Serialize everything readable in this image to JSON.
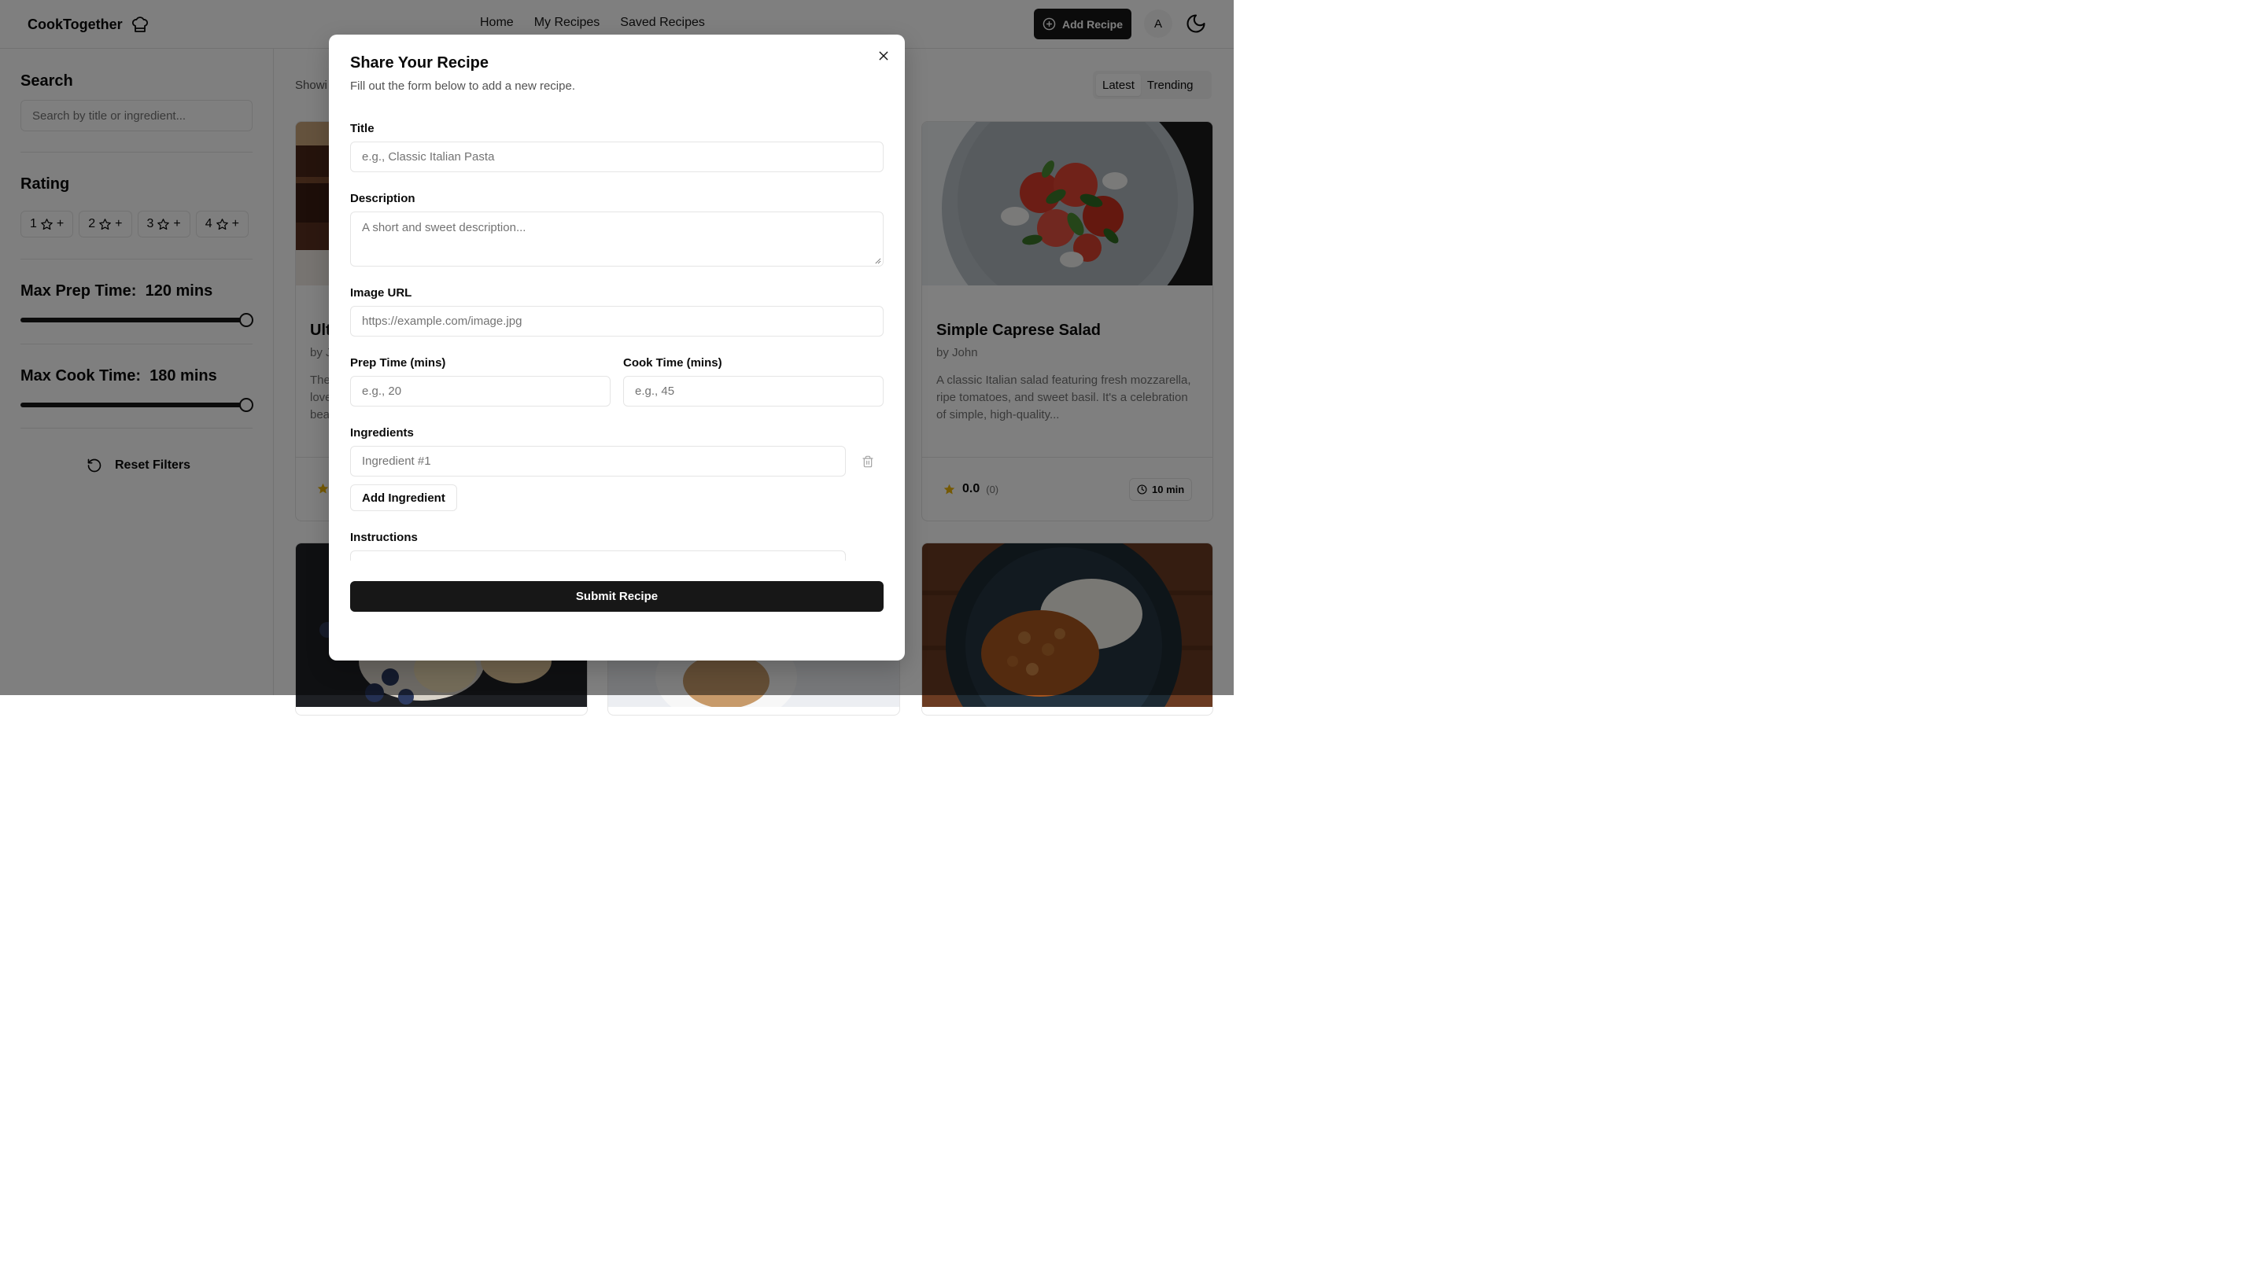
{
  "header": {
    "brand": "CookTogether",
    "nav": [
      "Home",
      "My Recipes",
      "Saved Recipes"
    ],
    "add_recipe": "Add Recipe",
    "avatar_initial": "A"
  },
  "sidebar": {
    "search_heading": "Search",
    "search_placeholder": "Search by title or ingredient...",
    "rating_heading": "Rating",
    "rating_buttons": [
      "1",
      "2",
      "3",
      "4"
    ],
    "rating_plus": "+",
    "prep_label": "Max Prep Time:",
    "prep_value": "120 mins",
    "prep_fraction": 1.0,
    "cook_label": "Max Cook Time:",
    "cook_value": "180 mins",
    "cook_fraction": 1.0,
    "reset": "Reset Filters"
  },
  "main": {
    "showing": "Showi",
    "sort": [
      "Latest",
      "Trending"
    ],
    "cards": [
      {
        "title_partial": "Ult",
        "author_partial": "by J",
        "desc_partial": [
          "The",
          "love",
          "bea"
        ]
      },
      {
        "title": "Simple Caprese Salad",
        "author": "by John",
        "description": "A classic Italian salad featuring fresh mozzarella, ripe tomatoes, and sweet basil. It's a celebration of simple, high-quality...",
        "rating": "0.0",
        "rating_count": "(0)",
        "time": "10 min"
      }
    ]
  },
  "modal": {
    "title": "Share Your Recipe",
    "subtitle": "Fill out the form below to add a new recipe.",
    "title_label": "Title",
    "title_placeholder": "e.g., Classic Italian Pasta",
    "description_label": "Description",
    "description_placeholder": "A short and sweet description...",
    "image_label": "Image URL",
    "image_placeholder": "https://example.com/image.jpg",
    "prep_label": "Prep Time (mins)",
    "prep_placeholder": "e.g., 20",
    "cook_label": "Cook Time (mins)",
    "cook_placeholder": "e.g., 45",
    "ingredients_label": "Ingredients",
    "ingredient_placeholder": "Ingredient #1",
    "add_ingredient": "Add Ingredient",
    "instructions_label": "Instructions",
    "submit": "Submit Recipe"
  },
  "colors": {
    "primary": "#171717",
    "border": "#e5e5e5",
    "muted_text": "#737373",
    "star": "#eab308",
    "overlay": "rgba(0,0,0,0.5)"
  }
}
